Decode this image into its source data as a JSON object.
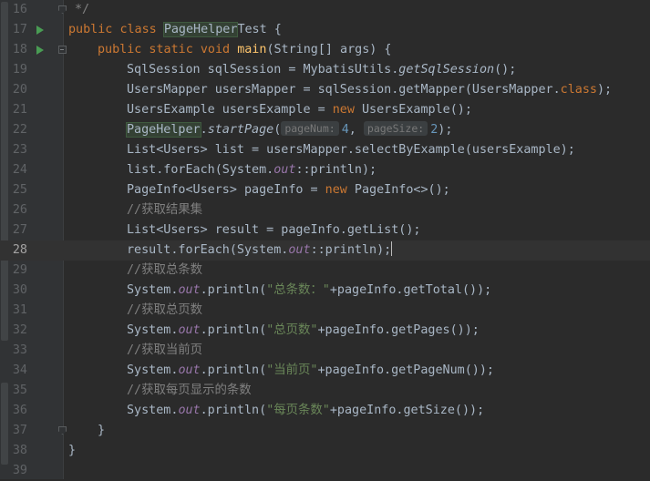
{
  "gutter": {
    "line_numbers": [
      "16",
      "17",
      "18",
      "19",
      "20",
      "21",
      "22",
      "23",
      "24",
      "25",
      "26",
      "27",
      "28",
      "29",
      "30",
      "31",
      "32",
      "33",
      "34",
      "35",
      "36",
      "37",
      "38",
      "39"
    ]
  },
  "code": {
    "l16": "*/",
    "l17_kw1": "public",
    "l17_kw2": "class",
    "l17_cls": "PageHelper",
    "l17_rest": "Test {",
    "l18_kw": "public static void",
    "l18_fn": "main",
    "l18_rest": "(String[] args) {",
    "l19_a": "SqlSession sqlSession = MybatisUtils.",
    "l19_m": "getSqlSession",
    "l19_b": "();",
    "l20_a": "UsersMapper usersMapper = sqlSession.getMapper(UsersMapper.",
    "l20_kw": "class",
    "l20_b": ");",
    "l21_a": "UsersExample usersExample = ",
    "l21_kw": "new",
    "l21_b": " UsersExample();",
    "l22_cls": "PageHelper",
    "l22_dot": ".",
    "l22_m": "startPage",
    "l22_open": "(",
    "l22_hint1": "pageNum:",
    "l22_v1": "4",
    "l22_comma": ",",
    "l22_hint2": "pageSize:",
    "l22_v2": "2",
    "l22_close": ");",
    "l23": "List<Users> list = usersMapper.selectByExample(usersExample);",
    "l24_a": "list.forEach(System.",
    "l24_f": "out",
    "l24_b": "::println);",
    "l25_a": "PageInfo<Users> pageInfo = ",
    "l25_kw": "new",
    "l25_b": " PageInfo<>();",
    "l26": "//获取结果集",
    "l27": "List<Users> result = pageInfo.getList();",
    "l28_a": "result.forEach(System.",
    "l28_f": "out",
    "l28_b": "::println);",
    "l29": "//获取总条数",
    "l30_a": "System.",
    "l30_f": "out",
    "l30_b": ".println(",
    "l30_s": "\"总条数：\"",
    "l30_c": "+pageInfo.getTotal());",
    "l31": "//获取总页数",
    "l32_a": "System.",
    "l32_f": "out",
    "l32_b": ".println(",
    "l32_s": "\"总页数\"",
    "l32_c": "+pageInfo.getPages());",
    "l33": "//获取当前页",
    "l34_a": "System.",
    "l34_f": "out",
    "l34_b": ".println(",
    "l34_s": "\"当前页\"",
    "l34_c": "+pageInfo.getPageNum());",
    "l35": "//获取每页显示的条数",
    "l36_a": "System.",
    "l36_f": "out",
    "l36_b": ".println(",
    "l36_s": "\"每页条数\"",
    "l36_c": "+pageInfo.getSize());",
    "l37": "}",
    "l38": "}"
  },
  "icons": {
    "run": "run-gutter-icon",
    "fold": "fold-marker-icon"
  },
  "colors": {
    "background": "#2b2b2b",
    "keyword": "#cc7832",
    "string": "#6a8759",
    "number": "#6897bb",
    "comment": "#808080",
    "method": "#ffc66d",
    "field": "#9876aa"
  }
}
